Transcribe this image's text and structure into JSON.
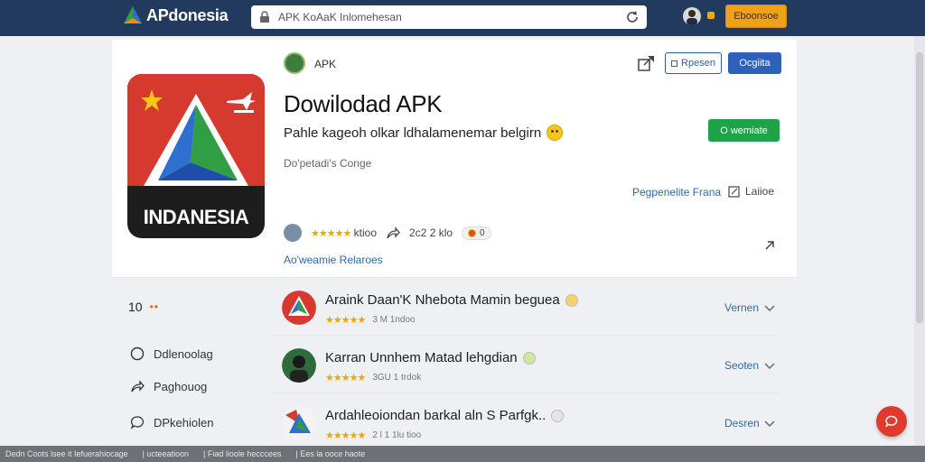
{
  "header": {
    "logo_text": "APdonesia",
    "url": "APK KoAaK Inlomehesan",
    "cta_label": "Eboonsoe"
  },
  "app": {
    "developer": "APK",
    "title": "Dowilodad APK",
    "subtitle": "Pahle kageoh olkar ldhalamenemar belgirn",
    "meta": "Do'petadi's Conge",
    "icon_text": "INDANESIA",
    "share_label": "",
    "outline_button": "Rpesen",
    "primary_button": "Ocgiita",
    "install_button": "O wemiate",
    "link_blue": "Pegpenelite Frana",
    "edit_link": "Laiioe",
    "rating_text": "★★★★★",
    "rating_label": "ktioo",
    "downloads": "2c2 2 klo",
    "pill_value": "0",
    "more_link": "Ao'weamie Relaroes"
  },
  "sidebar": {
    "heading": "10",
    "heading_dots": "••",
    "items": [
      {
        "label": "Ddlenoolag"
      },
      {
        "label": "Paghouog"
      },
      {
        "label": "DPkehiolen"
      }
    ]
  },
  "list": [
    {
      "title": "Araink Daan'K Nhebota Mamin beguea",
      "stars": "★★★★★",
      "meta": "3 M 1ndoo",
      "action": "Vernen"
    },
    {
      "title": "Karran Unnhem Matad lehgdian",
      "stars": "★★★★★",
      "meta": "3GU 1 trdok",
      "action": "Seoten"
    },
    {
      "title": "Ardahleoiondan barkal aln S Parfgk..",
      "stars": "★★★★★",
      "meta": "2 l 1 1lu tioo",
      "action": "Desren"
    }
  ],
  "statusbar": [
    "Dedn  Coots  lsee it Iefuerahiocage",
    "|  ucteeatioon",
    "|  Fiad lioole hecccees",
    "|  Ees la ooce haote"
  ],
  "colors": {
    "topbar": "#223a5e",
    "accent_orange": "#f0a11b",
    "primary_blue": "#2c63b8",
    "install_green": "#1ea446",
    "link_blue": "#2e6aa8",
    "icon_red": "#d63a2f"
  }
}
